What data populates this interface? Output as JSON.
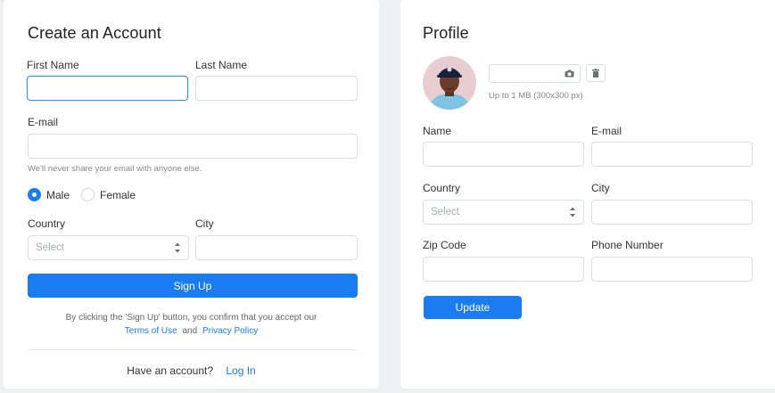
{
  "signup": {
    "title": "Create an Account",
    "first_name_label": "First Name",
    "first_name_value": "",
    "last_name_label": "Last Name",
    "last_name_value": "",
    "email_label": "E-mail",
    "email_value": "",
    "email_hint": "We'll never share your email with anyone else.",
    "gender_options": [
      "Male",
      "Female"
    ],
    "gender_selected": "Male",
    "country_label": "Country",
    "country_placeholder": "Select",
    "city_label": "City",
    "city_value": "",
    "signup_button": "Sign Up",
    "terms_text": "By clicking the 'Sign Up' button, you confirm that you accept our",
    "terms_link": "Terms of Use",
    "terms_and": "and",
    "privacy_link": "Privacy Policy",
    "have_account_text": "Have an account?",
    "login_link": "Log In"
  },
  "profile": {
    "title": "Profile",
    "avatar_icon": "avatar-photo",
    "upload_hint": "Up to 1 MB (300x300 px)",
    "camera_icon": "camera-icon",
    "trash_icon": "trash-icon",
    "name_label": "Name",
    "name_value": "",
    "email_label": "E-mail",
    "email_value": "",
    "country_label": "Country",
    "country_placeholder": "Select",
    "city_label": "City",
    "city_value": "",
    "zip_label": "Zip Code",
    "zip_value": "",
    "phone_label": "Phone Number",
    "phone_value": "",
    "update_button": "Update"
  },
  "colors": {
    "accent": "#1a7cf0",
    "background": "#eef0f3",
    "card": "#ffffff",
    "border": "#dcdfe4"
  }
}
